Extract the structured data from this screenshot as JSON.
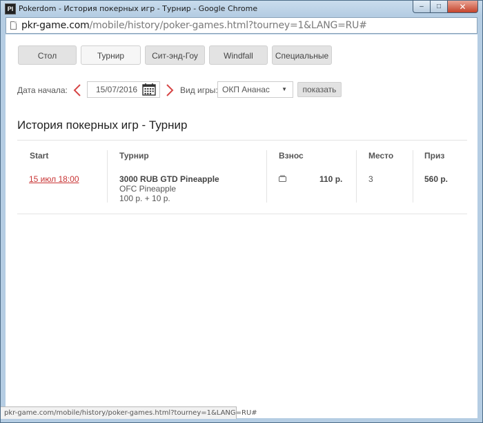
{
  "window": {
    "title": "Pokerdom - История покерных игр - Турнир - Google Chrome",
    "app_icon_label": "Pl",
    "minimize_glyph": "–",
    "maximize_glyph": "□",
    "close_glyph": "✕"
  },
  "address_bar": {
    "host": "pkr-game.com",
    "path": "/mobile/history/poker-games.html?tourney=1&LANG=RU#"
  },
  "tabs": [
    {
      "label": "Стол",
      "active": false
    },
    {
      "label": "Турнир",
      "active": true
    },
    {
      "label": "Сит-энд-Гоу",
      "active": false
    },
    {
      "label": "Windfall",
      "active": false
    },
    {
      "label": "Специальные",
      "active": false
    }
  ],
  "filters": {
    "start_date_label": "Дата начала:",
    "start_date_value": "15/07/2016",
    "game_type_label": "Вид игры:",
    "game_type_selected": "ОКП Ананас",
    "show_button": "показать"
  },
  "page_title": "История покерных игр - Турнир",
  "table": {
    "headers": {
      "start": "Start",
      "tournament": "Турнир",
      "buyin": "Взнос",
      "place": "Место",
      "prize": "Приз"
    },
    "rows": [
      {
        "start": "15 июл 18:00",
        "tournament_name": "3000 RUB GTD Pineapple",
        "game": "OFC Pineapple",
        "buyin_breakdown": "100 р. + 10 р.",
        "buyin_total": "110 р.",
        "place": "3",
        "prize": "560 р."
      }
    ]
  },
  "status_bar": "pkr-game.com/mobile/history/poker-games.html?tourney=1&LANG=RU#",
  "colors": {
    "link_red": "#c83232",
    "arrow_red": "#d64545"
  },
  "icons": [
    "page-icon",
    "prev-arrow-icon",
    "next-arrow-icon",
    "calendar-icon",
    "chevron-down-icon",
    "chip-icon"
  ]
}
